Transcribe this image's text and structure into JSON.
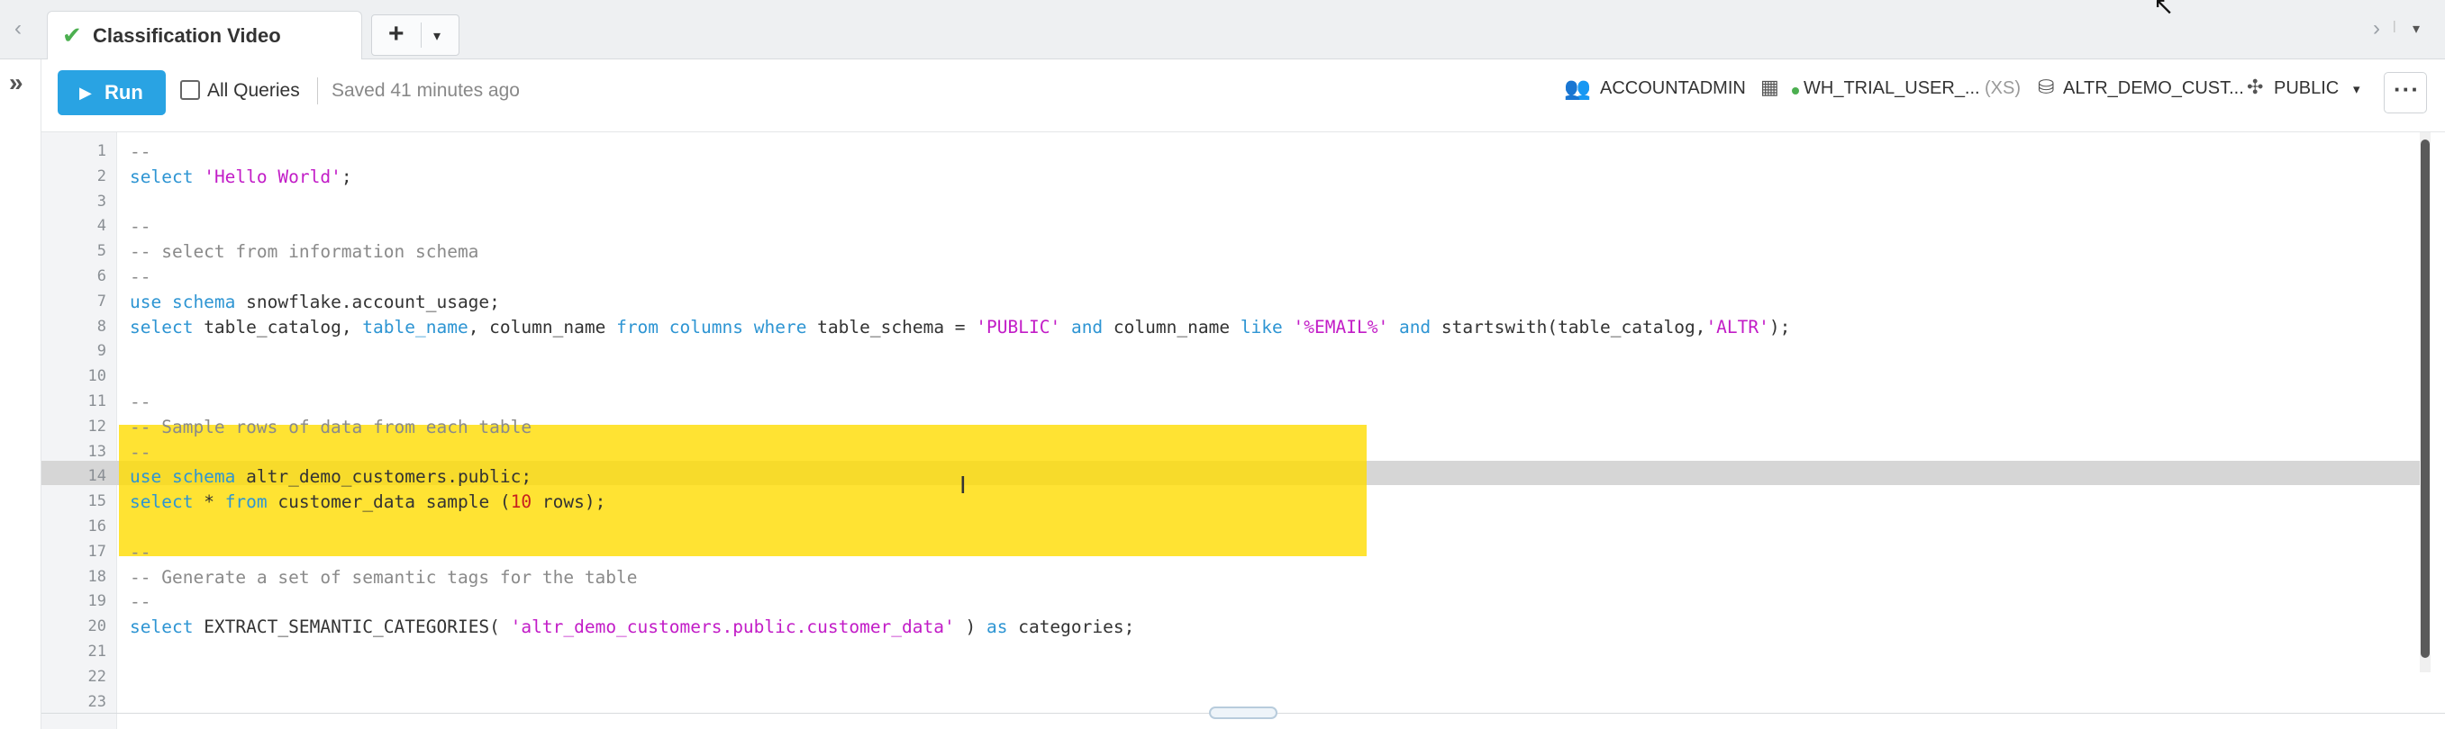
{
  "tab": {
    "title": "Classification Video",
    "add_label": "+",
    "nav_prev": "‹",
    "nav_next": "›",
    "menu_caret": "▾"
  },
  "toolbar": {
    "run_label": "Run",
    "all_queries_label": "All Queries",
    "saved_text": "Saved 41 minutes ago",
    "role": "ACCOUNTADMIN",
    "warehouse": "WH_TRIAL_USER_...",
    "warehouse_size": "(XS)",
    "database": "ALTR_DEMO_CUST...",
    "schema": "PUBLIC",
    "more": "···"
  },
  "editor": {
    "line_numbers": [
      "1",
      "2",
      "3",
      "4",
      "5",
      "6",
      "7",
      "8",
      "9",
      "10",
      "11",
      "12",
      "13",
      "14",
      "15",
      "16",
      "17",
      "18",
      "19",
      "20",
      "21",
      "22",
      "23"
    ],
    "lines": [
      [
        {
          "t": "--",
          "c": "cm"
        }
      ],
      [
        {
          "t": "select",
          "c": "kw"
        },
        {
          "t": " "
        },
        {
          "t": "'Hello World'",
          "c": "str"
        },
        {
          "t": ";"
        }
      ],
      [],
      [
        {
          "t": "--",
          "c": "cm"
        }
      ],
      [
        {
          "t": "-- select from information schema",
          "c": "cm"
        }
      ],
      [
        {
          "t": "--",
          "c": "cm"
        }
      ],
      [
        {
          "t": "use schema",
          "c": "kw"
        },
        {
          "t": " snowflake.account_usage;"
        }
      ],
      [
        {
          "t": "select",
          "c": "kw"
        },
        {
          "t": " table_catalog, "
        },
        {
          "t": "table_name",
          "c": "kw"
        },
        {
          "t": ", column_name "
        },
        {
          "t": "from",
          "c": "kw"
        },
        {
          "t": " "
        },
        {
          "t": "columns",
          "c": "kw"
        },
        {
          "t": " "
        },
        {
          "t": "where",
          "c": "kw"
        },
        {
          "t": " table_schema = "
        },
        {
          "t": "'PUBLIC'",
          "c": "str"
        },
        {
          "t": " "
        },
        {
          "t": "and",
          "c": "kw"
        },
        {
          "t": " column_name "
        },
        {
          "t": "like",
          "c": "kw"
        },
        {
          "t": " "
        },
        {
          "t": "'%EMAIL%'",
          "c": "str"
        },
        {
          "t": " "
        },
        {
          "t": "and",
          "c": "kw"
        },
        {
          "t": " startswith(table_catalog,"
        },
        {
          "t": "'ALTR'",
          "c": "str"
        },
        {
          "t": ");"
        }
      ],
      [],
      [],
      [
        {
          "t": "--",
          "c": "cm"
        }
      ],
      [
        {
          "t": "-- Sample rows of data from each table",
          "c": "cm"
        }
      ],
      [
        {
          "t": "--",
          "c": "cm"
        }
      ],
      [
        {
          "t": "use schema",
          "c": "kw"
        },
        {
          "t": " altr_demo_customers.public;"
        }
      ],
      [
        {
          "t": "select",
          "c": "kw"
        },
        {
          "t": " * "
        },
        {
          "t": "from",
          "c": "kw"
        },
        {
          "t": " customer_data sample ("
        },
        {
          "t": "10",
          "c": "num"
        },
        {
          "t": " rows);"
        }
      ],
      [],
      [
        {
          "t": "--",
          "c": "cm"
        }
      ],
      [
        {
          "t": "-- Generate a set of semantic tags for the table",
          "c": "cm"
        }
      ],
      [
        {
          "t": "--",
          "c": "cm"
        }
      ],
      [
        {
          "t": "select",
          "c": "kw"
        },
        {
          "t": " EXTRACT_SEMANTIC_CATEGORIES( "
        },
        {
          "t": "'altr_demo_customers.public.customer_data'",
          "c": "str"
        },
        {
          "t": " ) "
        },
        {
          "t": "as",
          "c": "kw"
        },
        {
          "t": " categories;"
        }
      ],
      [],
      [],
      []
    ]
  },
  "colors": {
    "run_button": "#29a3e3",
    "keyword": "#2e95d3",
    "string": "#c21cc7",
    "number": "#c71f1f",
    "comment": "#8a8a8a",
    "highlight": "#ffdc00",
    "tab_check": "#4caf50"
  },
  "icons": {
    "tab_status": "check-icon",
    "sidebar_toggle": "double-chevron-right-icon",
    "run": "play-icon",
    "role": "users-icon",
    "warehouse": "grid-icon",
    "database": "database-icon",
    "schema": "schema-icon"
  }
}
